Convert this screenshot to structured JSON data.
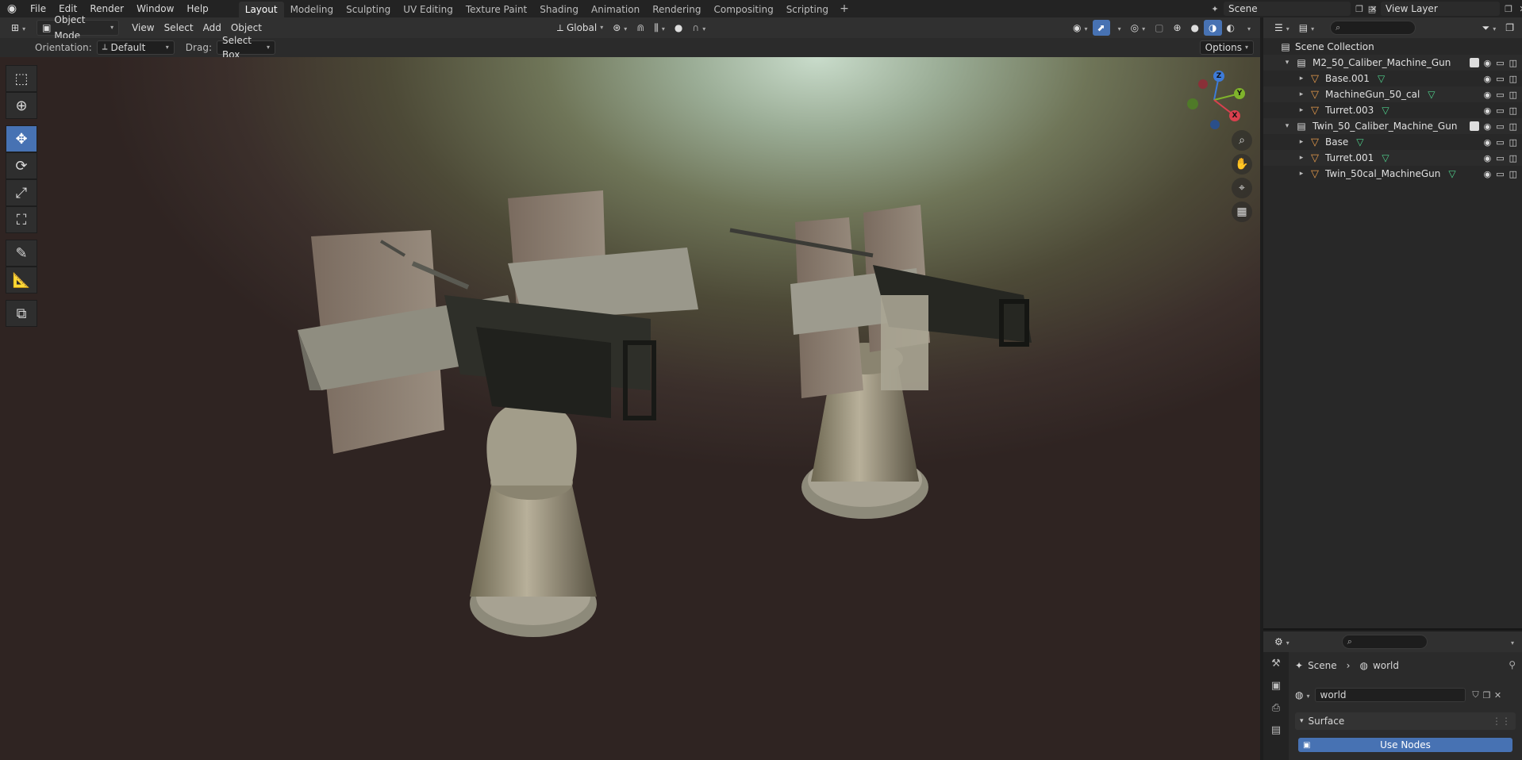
{
  "topbar": {
    "menus": [
      "File",
      "Edit",
      "Render",
      "Window",
      "Help"
    ],
    "workspaces": [
      "Layout",
      "Modeling",
      "Sculpting",
      "UV Editing",
      "Texture Paint",
      "Shading",
      "Animation",
      "Rendering",
      "Compositing",
      "Scripting"
    ],
    "active_workspace": "Layout",
    "scene_name": "Scene",
    "view_layer": "View Layer"
  },
  "view_header": {
    "mode": "Object Mode",
    "menus": [
      "View",
      "Select",
      "Add",
      "Object"
    ],
    "transform_orientation": "Global"
  },
  "tool_settings": {
    "orientation_label": "Orientation:",
    "orientation_value": "Default",
    "drag_label": "Drag:",
    "drag_value": "Select Box",
    "options_label": "Options"
  },
  "gizmo": {
    "z": "Z",
    "y": "Y",
    "x": "X"
  },
  "outliner": {
    "root": "Scene Collection",
    "rows": [
      {
        "label": "M2_50_Caliber_Machine_Gun",
        "type": "collection",
        "indent": 1
      },
      {
        "label": "Base.001",
        "type": "object",
        "indent": 2
      },
      {
        "label": "MachineGun_50_cal",
        "type": "object",
        "indent": 2
      },
      {
        "label": "Turret.003",
        "type": "object",
        "indent": 2
      },
      {
        "label": "Twin_50_Caliber_Machine_Gun",
        "type": "collection",
        "indent": 1
      },
      {
        "label": "Base",
        "type": "object",
        "indent": 2
      },
      {
        "label": "Turret.001",
        "type": "object",
        "indent": 2
      },
      {
        "label": "Twin_50cal_MachineGun",
        "type": "object",
        "indent": 2
      }
    ]
  },
  "properties": {
    "breadcrumb_scene": "Scene",
    "breadcrumb_world": "world",
    "world_name": "world",
    "panel_surface": "Surface",
    "use_nodes": "Use Nodes"
  },
  "colors": {
    "accent": "#4772b3",
    "object_icon": "#e59a4c",
    "mesh_icon": "#4fd18c"
  }
}
